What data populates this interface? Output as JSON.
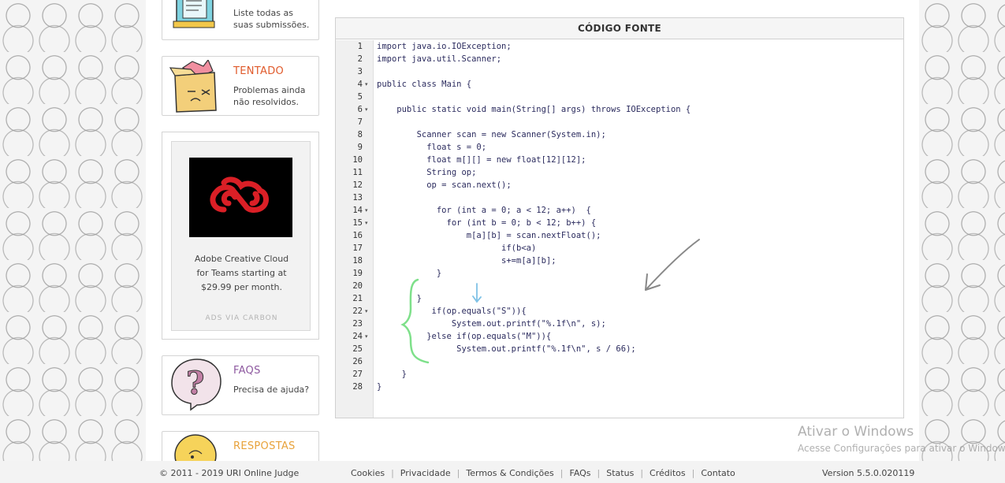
{
  "cards": {
    "submissions": {
      "desc": "Liste todas as suas submissões."
    },
    "tried": {
      "title": "TENTADO",
      "desc": "Problemas ainda não resolvidos.",
      "color": "#e05a2b"
    },
    "faqs": {
      "title": "FAQS",
      "desc": "Precisa de ajuda?",
      "color": "#8e5aa0"
    },
    "answers": {
      "title": "RESPOSTAS",
      "color": "#e8a23a"
    }
  },
  "ad": {
    "text_line1": "Adobe Creative Cloud",
    "text_line2": "for Teams starting at",
    "text_line3": "$29.99 per month.",
    "via": "ADS VIA CARBON",
    "logo_color": "#da1f26"
  },
  "code_panel": {
    "title": "CÓDIGO FONTE",
    "lines": [
      {
        "n": "1",
        "fold": "",
        "text": "import java.io.IOException;"
      },
      {
        "n": "2",
        "fold": "",
        "text": "import java.util.Scanner;"
      },
      {
        "n": "3",
        "fold": "",
        "text": ""
      },
      {
        "n": "4",
        "fold": "▾",
        "text": "public class Main {"
      },
      {
        "n": "5",
        "fold": "",
        "text": ""
      },
      {
        "n": "6",
        "fold": "▾",
        "text": "    public static void main(String[] args) throws IOException {"
      },
      {
        "n": "7",
        "fold": "",
        "text": ""
      },
      {
        "n": "8",
        "fold": "",
        "text": "        Scanner scan = new Scanner(System.in);"
      },
      {
        "n": "9",
        "fold": "",
        "text": "          float s = 0;"
      },
      {
        "n": "10",
        "fold": "",
        "text": "          float m[][] = new float[12][12];"
      },
      {
        "n": "11",
        "fold": "",
        "text": "          String op;"
      },
      {
        "n": "12",
        "fold": "",
        "text": "          op = scan.next();"
      },
      {
        "n": "13",
        "fold": "",
        "text": ""
      },
      {
        "n": "14",
        "fold": "▾",
        "text": "            for (int a = 0; a < 12; a++)  {"
      },
      {
        "n": "15",
        "fold": "▾",
        "text": "              for (int b = 0; b < 12; b++) {"
      },
      {
        "n": "16",
        "fold": "",
        "text": "                  m[a][b] = scan.nextFloat();"
      },
      {
        "n": "17",
        "fold": "",
        "text": "                         if(b<a)"
      },
      {
        "n": "18",
        "fold": "",
        "text": "                         s+=m[a][b];"
      },
      {
        "n": "19",
        "fold": "",
        "text": "            }"
      },
      {
        "n": "20",
        "fold": "",
        "text": ""
      },
      {
        "n": "21",
        "fold": "",
        "text": "        }"
      },
      {
        "n": "22",
        "fold": "▾",
        "text": "           if(op.equals(\"S\")){"
      },
      {
        "n": "23",
        "fold": "",
        "text": "               System.out.printf(\"%.1f\\n\", s);"
      },
      {
        "n": "24",
        "fold": "▾",
        "text": "          }else if(op.equals(\"M\")){"
      },
      {
        "n": "25",
        "fold": "",
        "text": "                System.out.printf(\"%.1f\\n\", s / 66);"
      },
      {
        "n": "26",
        "fold": "",
        "text": ""
      },
      {
        "n": "27",
        "fold": "",
        "text": "     }"
      },
      {
        "n": "28",
        "fold": "",
        "text": "}"
      }
    ]
  },
  "footer": {
    "copyright": "© 2011 - 2019 URI Online Judge",
    "links": [
      "Cookies",
      "Privacidade",
      "Termos & Condições",
      "FAQs",
      "Status",
      "Créditos",
      "Contato"
    ],
    "version": "Version 5.5.0.020119"
  },
  "windows_watermark": {
    "line1": "Ativar o Windows",
    "line2": "Acesse Configurações para ativar o Windows."
  }
}
